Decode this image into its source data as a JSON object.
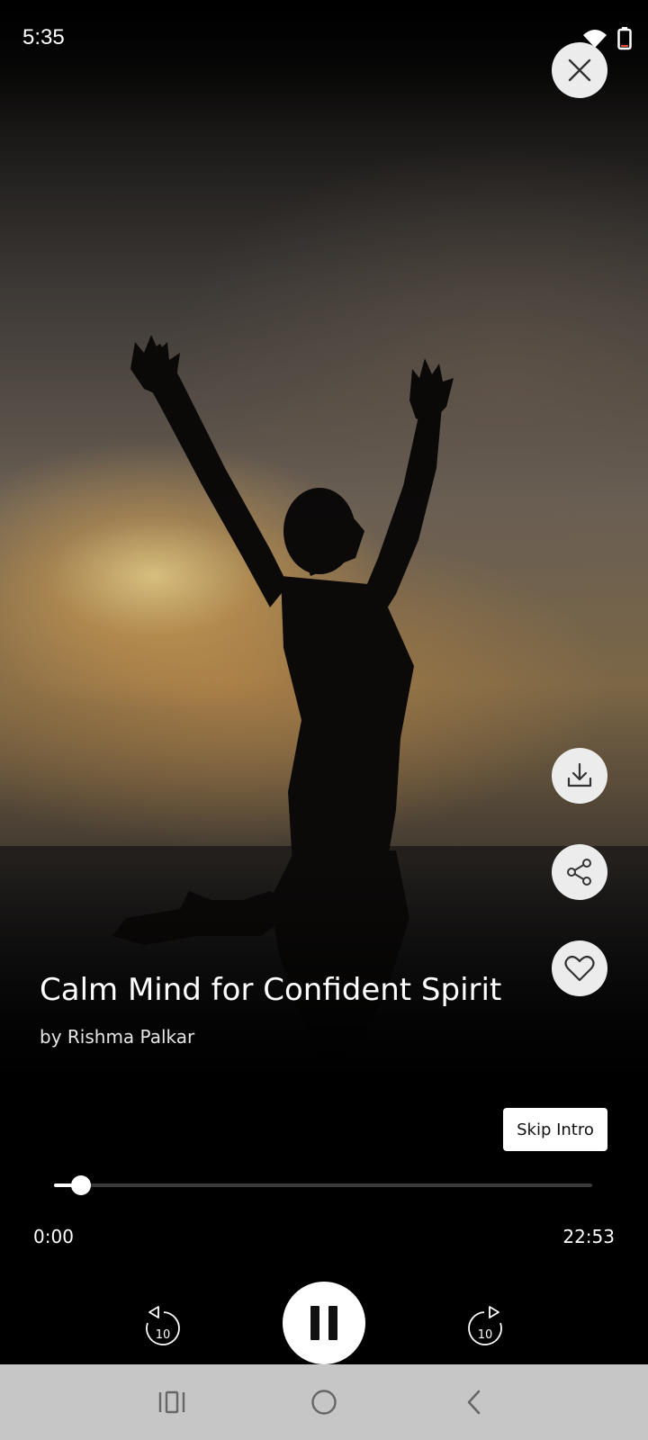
{
  "status_bar": {
    "time": "5:35"
  },
  "track": {
    "title": "Calm Mind for Confident Spirit",
    "author": "by Rishma Palkar"
  },
  "player": {
    "skip_intro_label": "Skip Intro",
    "elapsed": "0:00",
    "total": "22:53",
    "progress_fraction": 0.05,
    "rewind_seconds": "10",
    "forward_seconds": "10",
    "state": "playing"
  },
  "actions": {
    "close_icon": "close-icon",
    "download_icon": "download-icon",
    "share_icon": "share-icon",
    "favorite_icon": "heart-icon"
  },
  "colors": {
    "button_bg": "#ececec",
    "nav_bar": "#c6c6c6",
    "progress_track": "#3a3a3a"
  }
}
